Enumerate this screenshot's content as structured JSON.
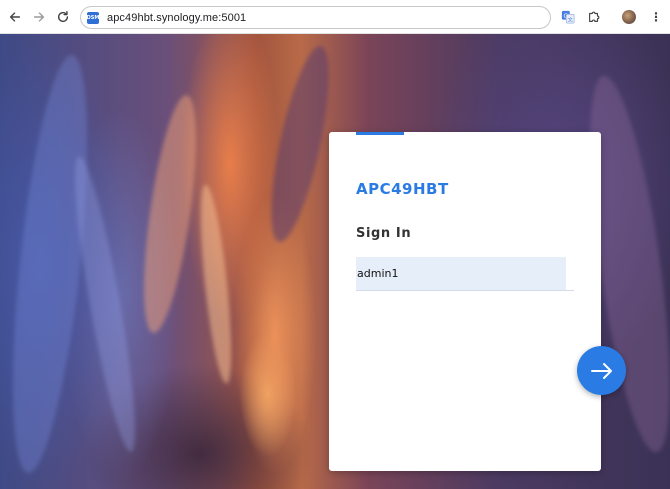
{
  "browser": {
    "url": "apc49hbt.synology.me:5001",
    "favicon_text": "DSM",
    "nav_icons": [
      "back-arrow-icon",
      "forward-arrow-icon",
      "reload-icon"
    ],
    "toolbar_icons": [
      "translate-icon",
      "extensions-puzzle-icon",
      "profile-avatar",
      "kebab-menu-icon"
    ],
    "menu_glyph": "⋮"
  },
  "login": {
    "hostname": "APC49HBT",
    "heading": "Sign In",
    "username_value": "admin1",
    "accent_color": "#2a7be4",
    "next_icon": "arrow-right-icon"
  }
}
